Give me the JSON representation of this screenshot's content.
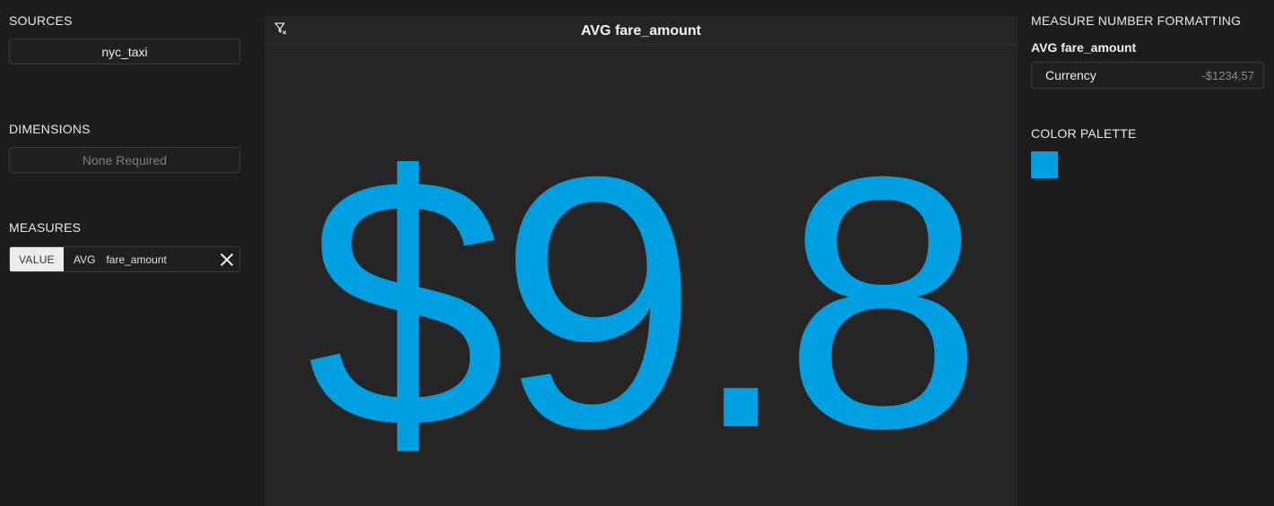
{
  "left": {
    "sources_title": "SOURCES",
    "source_name": "nyc_taxi",
    "dimensions_title": "DIMENSIONS",
    "dimensions_placeholder": "None Required",
    "measures_title": "MEASURES",
    "measure": {
      "role": "VALUE",
      "aggregation": "AVG",
      "field": "fare_amount"
    }
  },
  "center": {
    "title": "AVG fare_amount",
    "value": "$9.8",
    "value_color": "#009fe1",
    "filter_icon": "filter-clear-icon"
  },
  "right": {
    "formatting_title": "MEASURE NUMBER FORMATTING",
    "measure_name": "AVG fare_amount",
    "format_name": "Currency",
    "format_example": "-$1234,57",
    "palette_title": "COLOR PALETTE",
    "palette_colors": [
      "#009fe1"
    ]
  }
}
